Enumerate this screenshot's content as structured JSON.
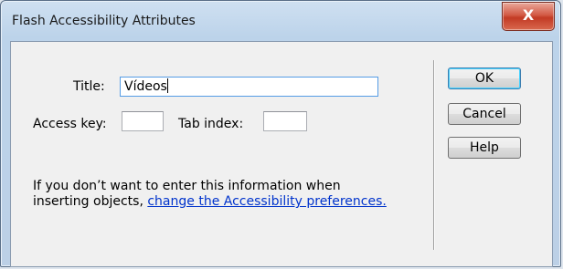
{
  "window": {
    "title": "Flash Accessibility Attributes",
    "close_glyph": "X"
  },
  "form": {
    "title_label": "Title:",
    "title_value": "Vídeos",
    "access_key_label": "Access key:",
    "access_key_value": "",
    "tab_index_label": "Tab index:",
    "tab_index_value": ""
  },
  "buttons": {
    "ok": "OK",
    "cancel": "Cancel",
    "help": "Help"
  },
  "info": {
    "line1": "If you don’t want to enter this information when",
    "line2_prefix": "inserting objects, ",
    "link_text": "change the Accessibility preferences."
  },
  "colors": {
    "link": "#0033cc",
    "close_button": "#c23a24",
    "focus_border": "#569de5"
  },
  "icons": {
    "close": "close-icon"
  }
}
